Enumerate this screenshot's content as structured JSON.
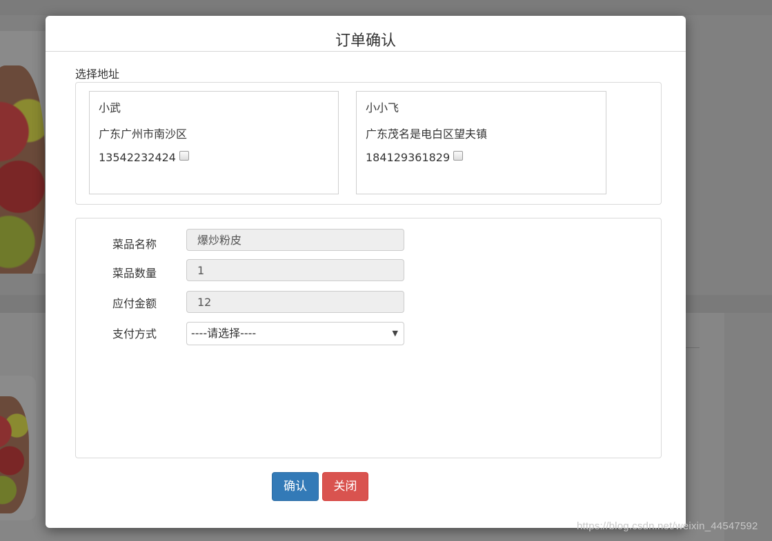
{
  "modal": {
    "title": "订单确认"
  },
  "address": {
    "label": "选择地址",
    "cards": [
      {
        "name": "小武",
        "street": "广东广州市南沙区",
        "phone": "13542232424",
        "checked": false
      },
      {
        "name": "小小飞",
        "street": "广东茂名是电白区望夫镇",
        "phone": "184129361829",
        "checked": false
      }
    ]
  },
  "order": {
    "dish_name_label": "菜品名称",
    "dish_name_value": "爆炒粉皮",
    "quantity_label": "菜品数量",
    "quantity_value": "1",
    "amount_label": "应付金额",
    "amount_value": "12",
    "payment_label": "支付方式",
    "payment_selected": "----请选择----"
  },
  "buttons": {
    "confirm": "确认",
    "close": "关闭"
  },
  "watermark": "https://blog.csdn.net/weixin_44547592",
  "colors": {
    "primary": "#337ab7",
    "danger": "#d9534f",
    "input_disabled_bg": "#eeeeee"
  }
}
